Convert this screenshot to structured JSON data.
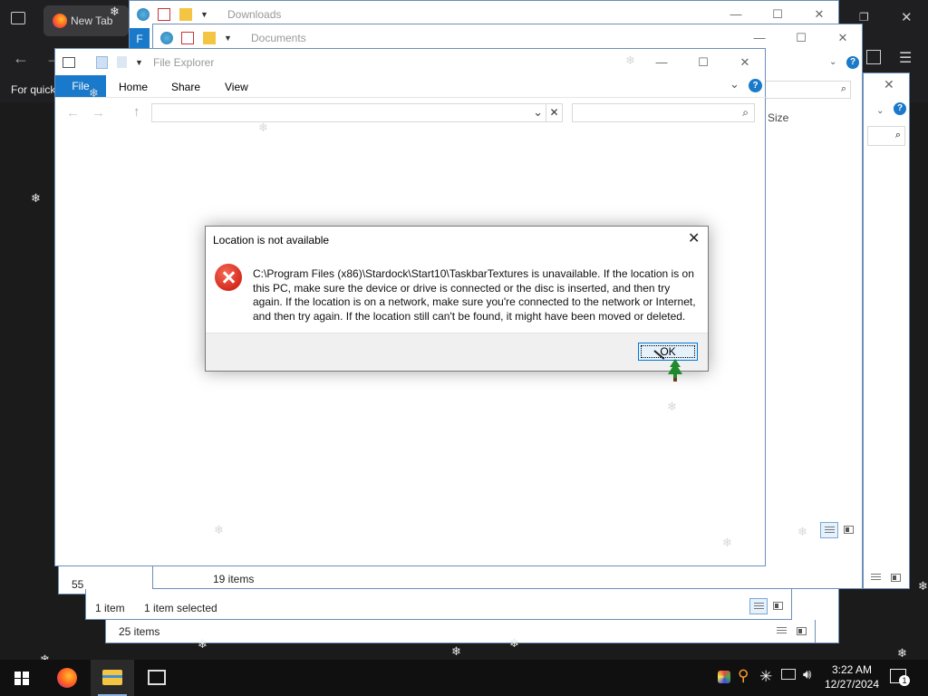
{
  "browser": {
    "tab_label": "New Tab",
    "sidebar_text": "For quick"
  },
  "windows": {
    "downloads": {
      "title": "Downloads",
      "status_count": "25 items"
    },
    "documents": {
      "title": "Documents",
      "status_count": "19 items",
      "col_header": "Size"
    },
    "back_partial": {
      "status_count": "55"
    },
    "file_explorer": {
      "title": "File Explorer",
      "tabs": [
        "File",
        "Home",
        "Share",
        "View"
      ],
      "status_items": "1 item",
      "status_selected": "1 item selected"
    },
    "partial_file_tab": "F"
  },
  "dialog": {
    "title": "Location is not available",
    "message": "C:\\Program Files (x86)\\Stardock\\Start10\\TaskbarTextures is unavailable. If the location is on this PC, make sure the device or drive is connected or the disc is inserted, and then try again. If the location is on a network, make sure you're connected to the network or Internet, and then try again. If the location still can't be found, it might have been moved or deleted.",
    "ok_label": "OK",
    "close_icon": "close-icon",
    "error_icon": "error-icon"
  },
  "taskbar": {
    "time": "3:22 AM",
    "date": "12/27/2024",
    "notification_count": "1",
    "apps": [
      "start",
      "firefox",
      "file-explorer",
      "start10-app"
    ]
  },
  "colors": {
    "accent": "#1979ca",
    "error": "#d52b1e",
    "taskbar": "#101010"
  }
}
